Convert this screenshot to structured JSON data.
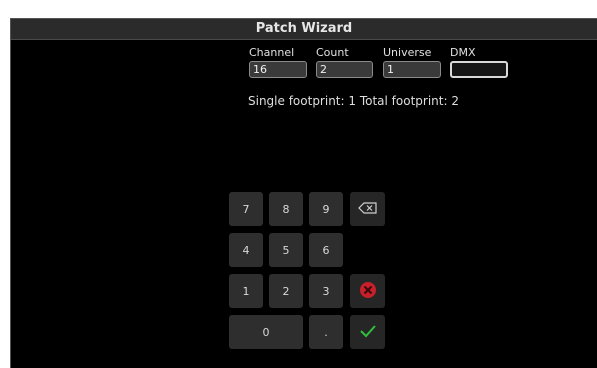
{
  "window": {
    "title": "Patch Wizard"
  },
  "fields": [
    {
      "label": "Channel",
      "value": "16"
    },
    {
      "label": "Count",
      "value": "2"
    },
    {
      "label": "Universe",
      "value": "1"
    },
    {
      "label": "DMX",
      "value": ""
    }
  ],
  "footprint": {
    "text": "Single footprint: 1 Total footprint: 2"
  },
  "keypad": {
    "keys": [
      "7",
      "8",
      "9",
      "4",
      "5",
      "6",
      "1",
      "2",
      "3",
      "0",
      "."
    ],
    "backspace_icon": "backspace-icon",
    "cancel_icon": "cancel-icon",
    "confirm_icon": "checkmark-icon"
  },
  "colors": {
    "cancel_red": "#c8202a",
    "confirm_green": "#2fbf3a",
    "key_bg": "#2e2e2e"
  }
}
